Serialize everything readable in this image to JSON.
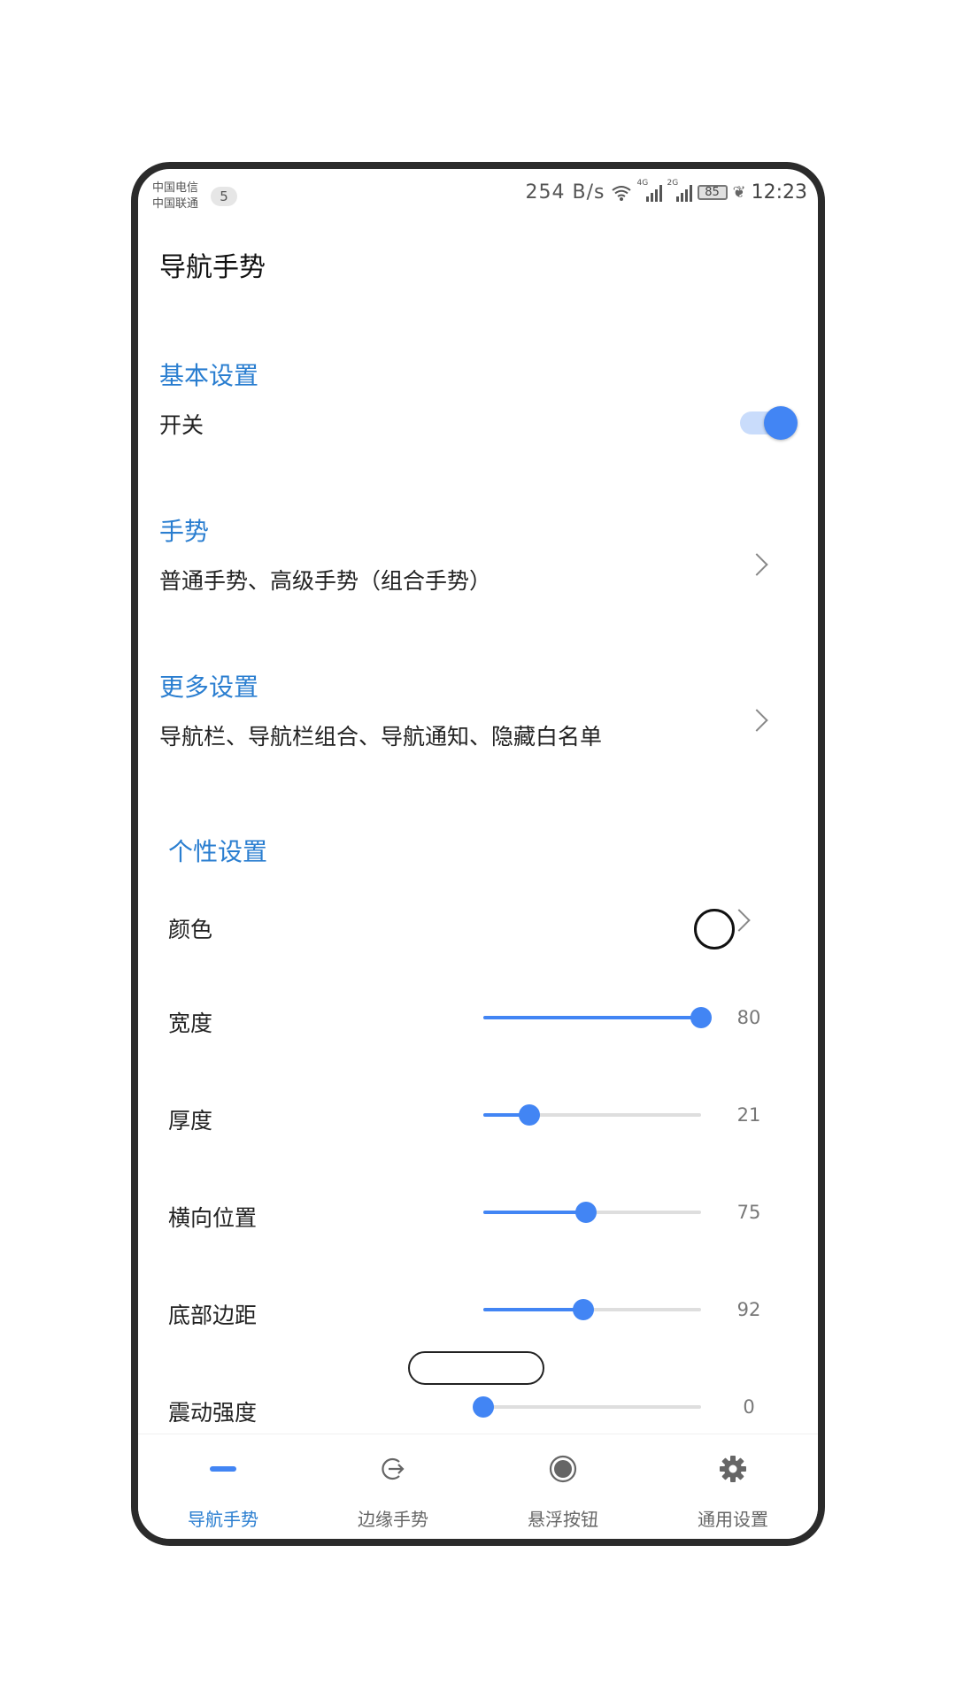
{
  "status_bar": {
    "carrier_1": "中国电信",
    "carrier_2": "中国联通",
    "notification_count": "5",
    "net_speed": "254 B/s",
    "sim1_tag": "4G",
    "sim2_tag": "2G",
    "battery": "85",
    "time": "12:23"
  },
  "header": {
    "title": "导航手势"
  },
  "basic": {
    "heading": "基本设置",
    "switch_label": "开关",
    "switch_on": true
  },
  "gestures": {
    "heading": "手势",
    "summary": "普通手势、高级手势（组合手势）"
  },
  "more": {
    "heading": "更多设置",
    "summary": "导航栏、导航栏组合、导航通知、隐藏白名单"
  },
  "personal": {
    "heading": "个性设置",
    "color_label": "颜色",
    "color_value": "#ffffff",
    "sliders": [
      {
        "label": "宽度",
        "value": "80",
        "fraction": 1.0
      },
      {
        "label": "厚度",
        "value": "21",
        "fraction": 0.21
      },
      {
        "label": "横向位置",
        "value": "75",
        "fraction": 0.47
      },
      {
        "label": "底部边距",
        "value": "92",
        "fraction": 0.46
      },
      {
        "label": "震动强度",
        "value": "0",
        "fraction": 0.0
      }
    ]
  },
  "bottom_nav": {
    "items": [
      {
        "label": "导航手势",
        "icon": "navbar-line-icon",
        "active": true
      },
      {
        "label": "边缘手势",
        "icon": "edge-arrow-icon",
        "active": false
      },
      {
        "label": "悬浮按钮",
        "icon": "floating-dot-icon",
        "active": false
      },
      {
        "label": "通用设置",
        "icon": "gear-icon",
        "active": false
      }
    ]
  },
  "colors": {
    "accent": "#2a7ed0",
    "slider": "#4285f4"
  }
}
